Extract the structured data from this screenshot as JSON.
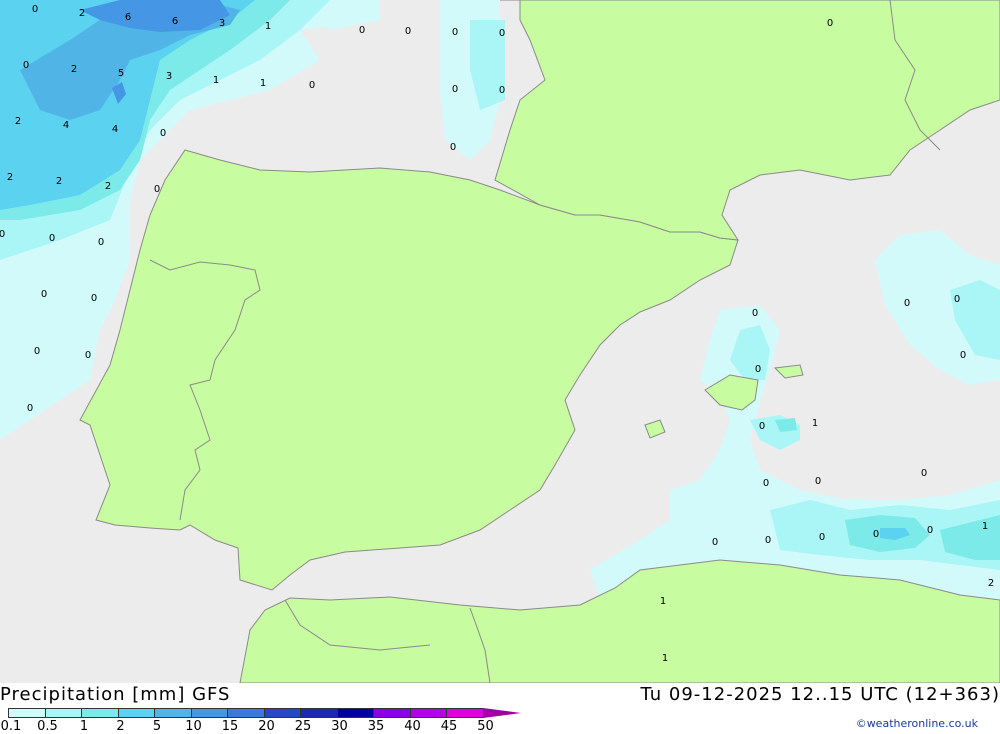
{
  "title": "Precipitation [mm] GFS",
  "datetime": "Tu 09-12-2025 12..15 UTC (12+363)",
  "credit": "©weatheronline.co.uk",
  "legend": {
    "ticks": [
      "0.1",
      "0.5",
      "1",
      "2",
      "5",
      "10",
      "15",
      "20",
      "25",
      "30",
      "35",
      "40",
      "45",
      "50"
    ],
    "colors": [
      "#d2fafa",
      "#aaf5f5",
      "#7deaea",
      "#5ad2f0",
      "#50b4e6",
      "#4696e6",
      "#3c78dc",
      "#2846c8",
      "#1e28b4",
      "#0000a0",
      "#8c00e6",
      "#b400e6",
      "#dc00dc",
      "#c800b4",
      "#a000a0"
    ]
  },
  "colors": {
    "sea": "#ececec",
    "land": "#c8fca0",
    "coast": "#8a8a8a"
  },
  "map_labels": [
    "0",
    "2",
    "6",
    "6",
    "3",
    "1",
    "0",
    "0",
    "0",
    "0",
    "0",
    "2",
    "5",
    "3",
    "1",
    "1",
    "0",
    "0",
    "0",
    "2",
    "4",
    "4",
    "0",
    "0",
    "2",
    "2",
    "2",
    "0",
    "0",
    "0",
    "0",
    "0",
    "0",
    "0",
    "0",
    "0",
    "0",
    "0",
    "0",
    "0",
    "1",
    "0",
    "0",
    "0",
    "0",
    "0",
    "0",
    "0",
    "0",
    "0",
    "0",
    "0",
    "1",
    "2",
    "1",
    "1",
    "0",
    "0",
    "0"
  ]
}
